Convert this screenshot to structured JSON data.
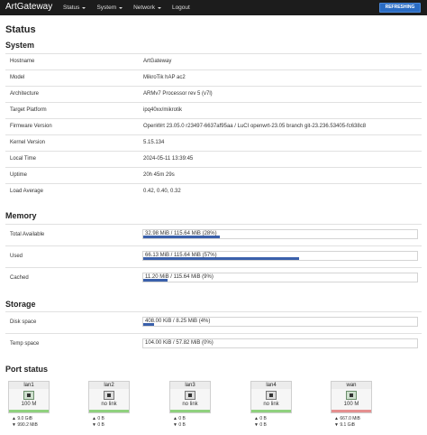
{
  "navbar": {
    "brand": "ArtGateway",
    "menu": [
      {
        "label": "Status",
        "has_caret": true
      },
      {
        "label": "System",
        "has_caret": true
      },
      {
        "label": "Network",
        "has_caret": true
      },
      {
        "label": "Logout",
        "has_caret": false
      }
    ],
    "refresh_label": "REFRESHING"
  },
  "page_title": "Status",
  "system": {
    "title": "System",
    "rows": [
      {
        "label": "Hostname",
        "value": "ArtGateway"
      },
      {
        "label": "Model",
        "value": "MikroTik hAP ac2"
      },
      {
        "label": "Architecture",
        "value": "ARMv7 Processor rev 5 (v7l)"
      },
      {
        "label": "Target Platform",
        "value": "ipq40xx/mikrotik"
      },
      {
        "label": "Firmware Version",
        "value": "OpenWrt 23.05.0 r23497-6637af95aa / LuCI openwrt-23.05 branch git-23.236.53405-fc638c8"
      },
      {
        "label": "Kernel Version",
        "value": "5.15.134"
      },
      {
        "label": "Local Time",
        "value": "2024-05-11 13:39:45"
      },
      {
        "label": "Uptime",
        "value": "20h 45m 29s"
      },
      {
        "label": "Load Average",
        "value": "0.42, 0.40, 0.32"
      }
    ]
  },
  "memory": {
    "title": "Memory",
    "rows": [
      {
        "label": "Total Available",
        "value": "32.98 MiB / 115.64 MiB (28%)",
        "percent": 28
      },
      {
        "label": "Used",
        "value": "66.13 MiB / 115.64 MiB (57%)",
        "percent": 57
      },
      {
        "label": "Cached",
        "value": "11.20 MiB / 115.64 MiB (9%)",
        "percent": 9
      }
    ]
  },
  "storage": {
    "title": "Storage",
    "rows": [
      {
        "label": "Disk space",
        "value": "408.00 KiB / 8.25 MiB (4%)",
        "percent": 4
      },
      {
        "label": "Temp space",
        "value": "104.00 KiB / 57.82 MiB (0%)",
        "percent": 0
      }
    ]
  },
  "port_status": {
    "title": "Port status",
    "ports": [
      {
        "name": "lan1",
        "speed": "100 M",
        "link": true,
        "bar_color": "#8fd17e",
        "rx": "▲ 9.0 GiB",
        "tx": "▼ 990.2 MiB"
      },
      {
        "name": "lan2",
        "speed": "no link",
        "link": false,
        "bar_color": "#8fd17e",
        "rx": "▲ 0 B",
        "tx": "▼ 0 B"
      },
      {
        "name": "lan3",
        "speed": "no link",
        "link": false,
        "bar_color": "#8fd17e",
        "rx": "▲ 0 B",
        "tx": "▼ 0 B"
      },
      {
        "name": "lan4",
        "speed": "no link",
        "link": false,
        "bar_color": "#8fd17e",
        "rx": "▲ 0 B",
        "tx": "▼ 0 B"
      },
      {
        "name": "wan",
        "speed": "100 M",
        "link": true,
        "bar_color": "#e58f8f",
        "rx": "▲ 667.0 MiB",
        "tx": "▼ 9.1 GiB"
      }
    ]
  },
  "colors": {
    "navbar_bg": "#1c1c1c",
    "refresh_button": "#2a6cc4",
    "progress_fill": "#3a60ab"
  }
}
